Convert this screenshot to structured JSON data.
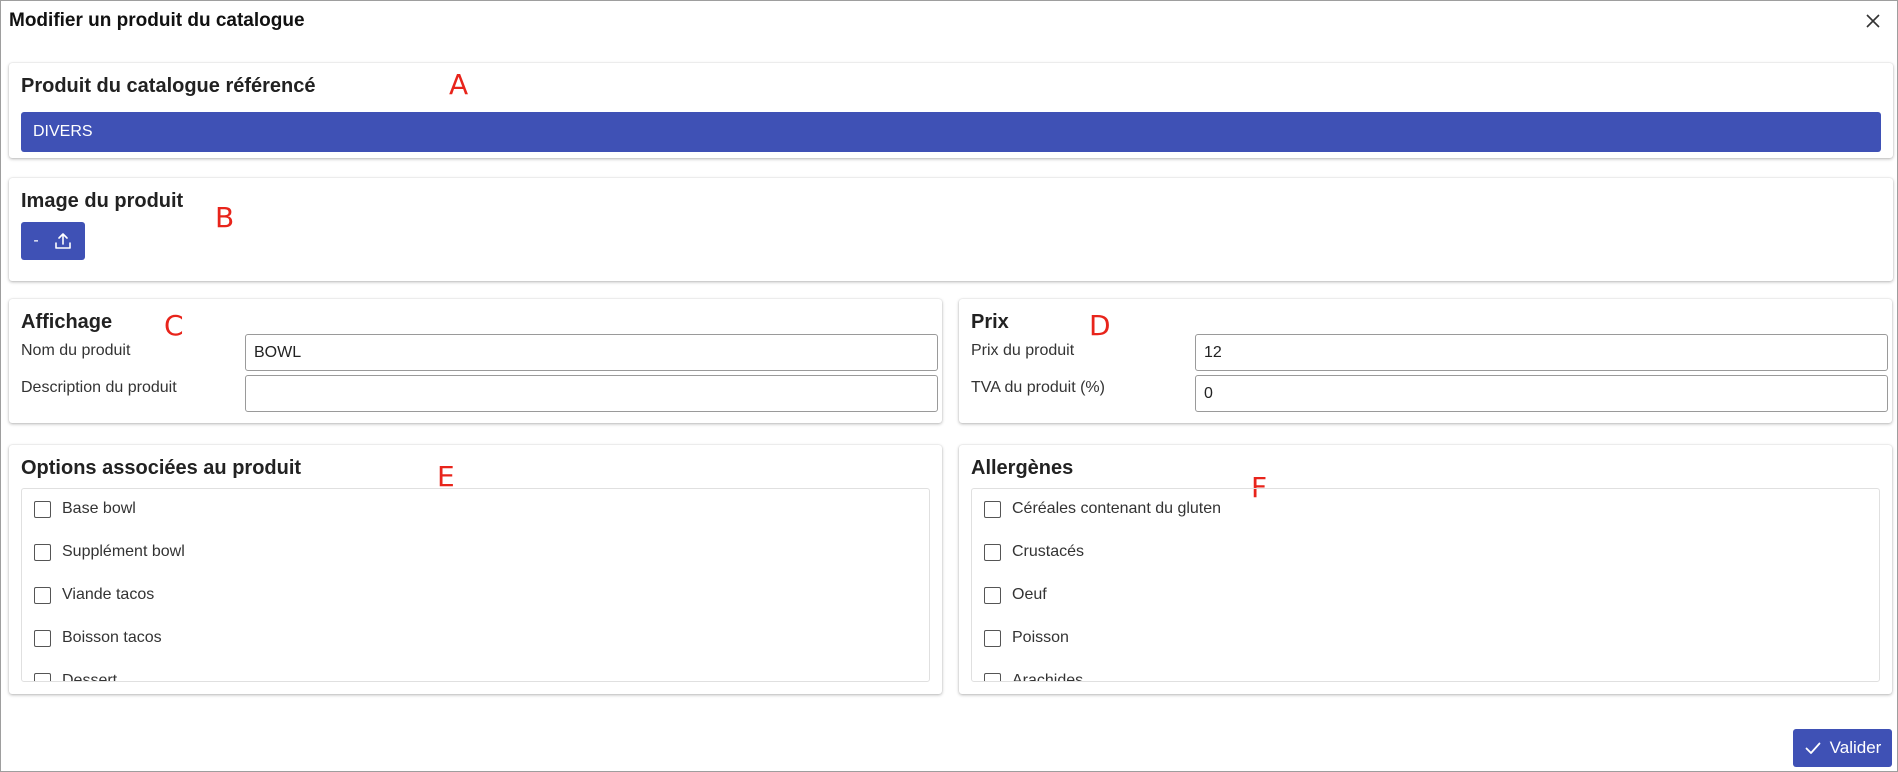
{
  "dialog": {
    "title": "Modifier un produit du catalogue",
    "close_icon": "close-icon",
    "submit_label": "Valider",
    "submit_icon": "check-icon"
  },
  "annotations": [
    "A",
    "B",
    "C",
    "D",
    "E",
    "F"
  ],
  "catalog": {
    "title": "Produit du catalogue référencé",
    "selected": "DIVERS"
  },
  "image": {
    "title": "Image du produit",
    "button_text": "-",
    "button_icon": "upload-icon"
  },
  "display": {
    "title": "Affichage",
    "name_label": "Nom du produit",
    "name_value": "BOWL",
    "description_label": "Description du produit",
    "description_value": ""
  },
  "price": {
    "title": "Prix",
    "price_label": "Prix du produit",
    "price_value": "12",
    "vat_label": "TVA du produit (%)",
    "vat_value": "0"
  },
  "options": {
    "title": "Options associées au produit",
    "items": [
      "Base bowl",
      "Supplément bowl",
      "Viande tacos",
      "Boisson tacos",
      "Dessert"
    ]
  },
  "allergens": {
    "title": "Allergènes",
    "items": [
      "Céréales contenant du gluten",
      "Crustacés",
      "Oeuf",
      "Poisson",
      "Arachides"
    ]
  },
  "colors": {
    "primary": "#3f51b5",
    "annotation": "#e8241b"
  }
}
